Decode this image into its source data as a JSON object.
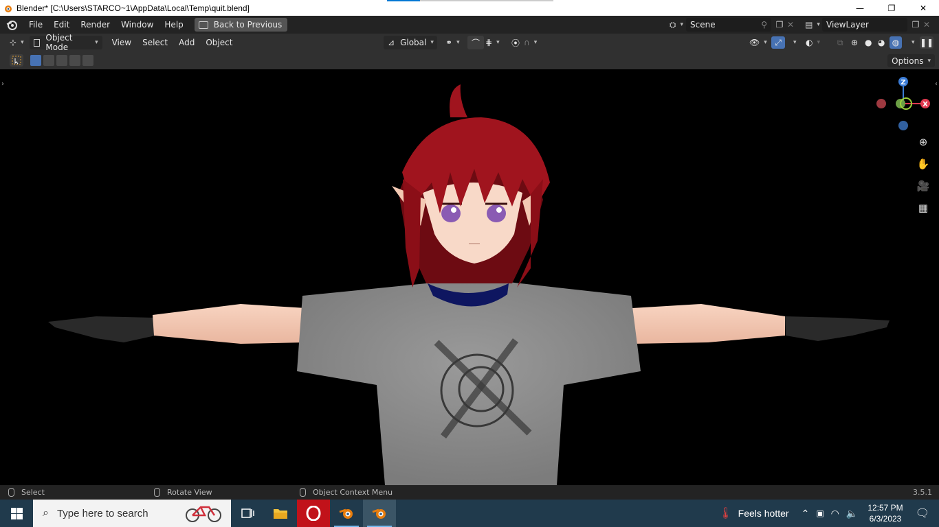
{
  "window": {
    "title": "Blender* [C:\\Users\\STARCO~1\\AppData\\Local\\Temp\\quit.blend]",
    "minimize": "—",
    "maximize": "❐",
    "close": "✕"
  },
  "menubar": {
    "items": [
      "File",
      "Edit",
      "Render",
      "Window",
      "Help"
    ],
    "back_label": "Back to Previous",
    "scene": "Scene",
    "view_layer": "ViewLayer"
  },
  "header": {
    "mode": "Object Mode",
    "menus": [
      "View",
      "Select",
      "Add",
      "Object"
    ],
    "transform_orientation": "Global"
  },
  "toolrow": {
    "options_label": "Options"
  },
  "gizmo": {
    "z_label": "Z",
    "x_label": "X",
    "colors": {
      "x": "#e0384e",
      "y": "#7fb428",
      "z": "#3a7bd5",
      "center": "#6c9f45"
    }
  },
  "statusbar": {
    "select": "Select",
    "rotate": "Rotate View",
    "context": "Object Context Menu",
    "version": "3.5.1"
  },
  "taskbar": {
    "search_placeholder": "Type here to search",
    "weather": "Feels hotter",
    "time": "12:57 PM",
    "date": "6/3/2023"
  },
  "colors": {
    "accent": "#4772b3",
    "hair": "#8b0e17",
    "shirt": "#8f8f8f",
    "skin": "#f3c9b3",
    "collar": "#0e1660",
    "taskbar": "#203a4c"
  }
}
